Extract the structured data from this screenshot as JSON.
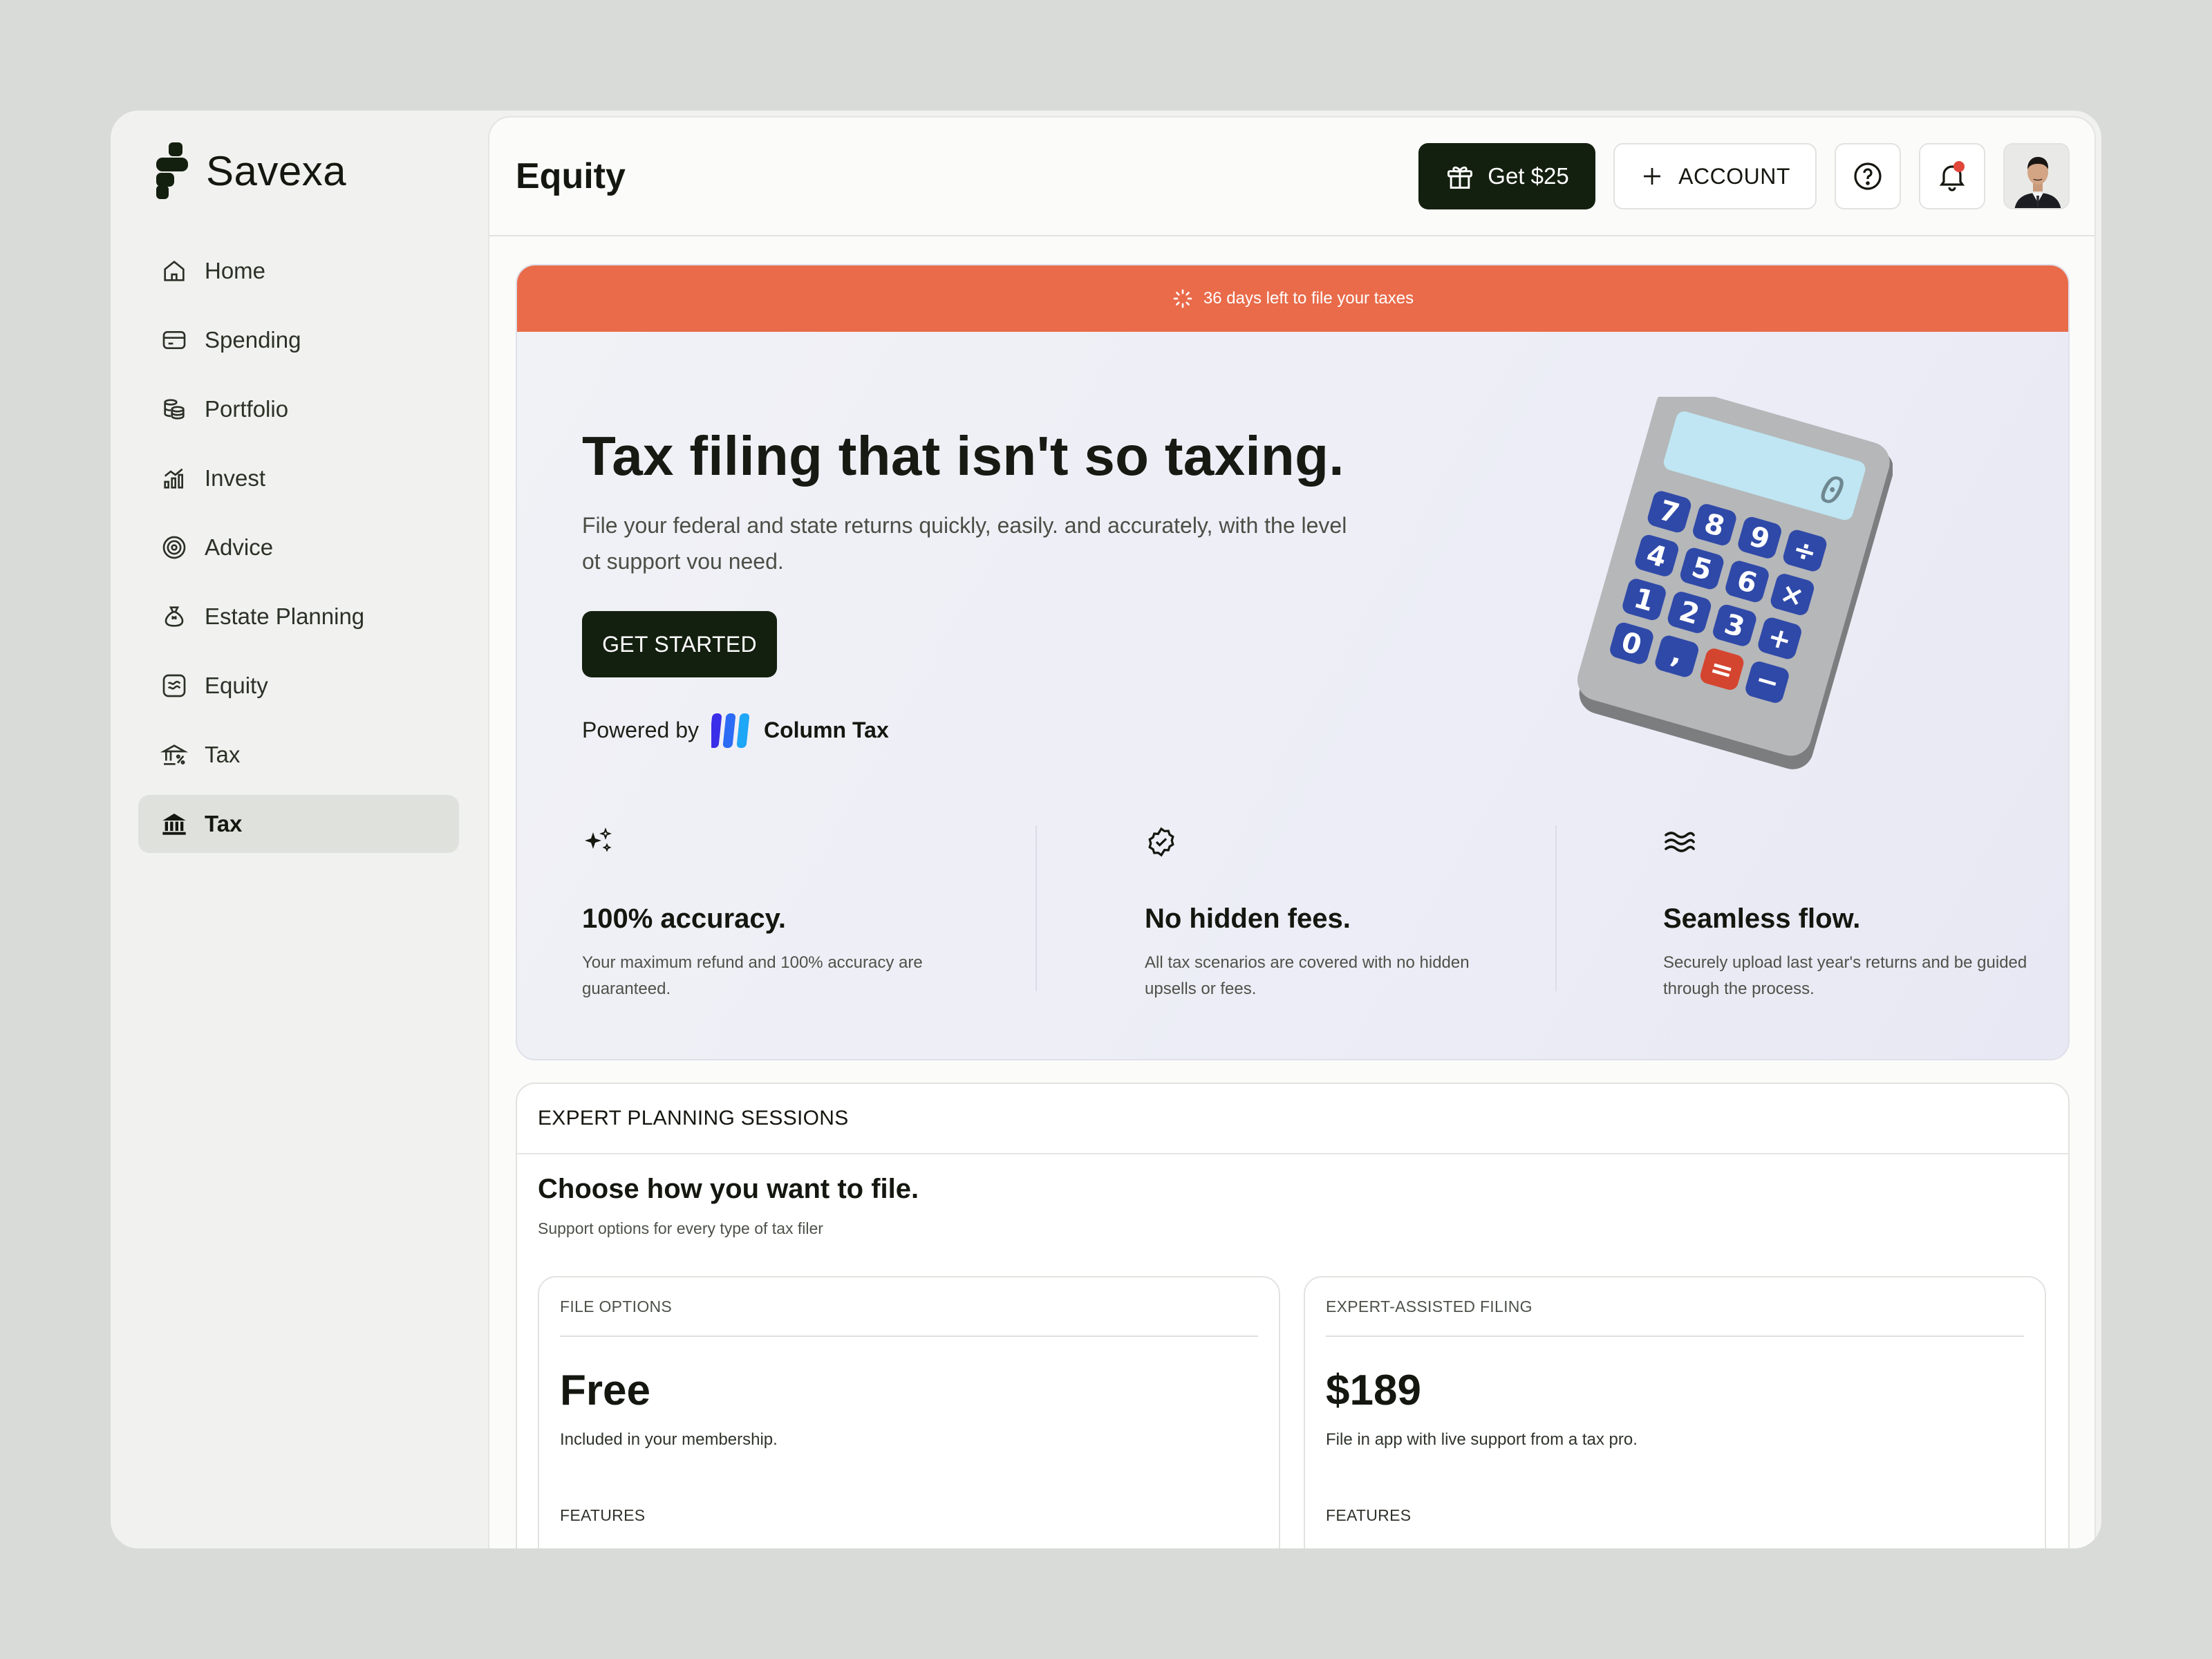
{
  "app": {
    "name": "Savexa"
  },
  "sidebar": {
    "items": [
      {
        "label": "Home",
        "icon": "home-icon"
      },
      {
        "label": "Spending",
        "icon": "card-icon"
      },
      {
        "label": "Portfolio",
        "icon": "coins-icon"
      },
      {
        "label": "Invest",
        "icon": "chart-icon"
      },
      {
        "label": "Advice",
        "icon": "target-icon"
      },
      {
        "label": "Estate Planning",
        "icon": "money-bag-icon"
      },
      {
        "label": "Equity",
        "icon": "equity-icon"
      },
      {
        "label": "Tax",
        "icon": "bank-percent-icon"
      },
      {
        "label": "Tax",
        "icon": "bank-icon",
        "active": true
      }
    ]
  },
  "header": {
    "title": "Equity",
    "gift_label": "Get $25",
    "account_label": "ACCOUNT"
  },
  "banner": {
    "text": "36 days left to file your taxes"
  },
  "hero": {
    "title": "Tax filing that isn't so taxing.",
    "subtitle": "File your federal and state returns quickly, easily. and accurately, with the level ot support vou need.",
    "cta_label": "GET STARTED",
    "powered_prefix": "Powered by",
    "powered_brand": "Column Tax",
    "calculator_display": "0"
  },
  "features": [
    {
      "title": "100% accuracy.",
      "desc": "Your maximum refund and 100% accuracy are guaranteed.",
      "icon": "sparkle-icon"
    },
    {
      "title": "No hidden fees.",
      "desc": "All tax scenarios are covered with no hidden upsells or fees.",
      "icon": "verified-badge-icon"
    },
    {
      "title": "Seamless flow.",
      "desc": "Securely upload last year's returns and be guided through the process.",
      "icon": "waves-icon"
    }
  ],
  "sessions": {
    "header": "EXPERT PLANNING SESSIONS",
    "title": "Choose how you want to file.",
    "subtitle": "Support options for every type of tax filer",
    "plans": [
      {
        "label": "FILE OPTIONS",
        "price": "Free",
        "desc": "Included in your membership.",
        "features_label": "FEATURES"
      },
      {
        "label": "EXPERT-ASSISTED FILING",
        "price": "$189",
        "desc": "File in app with live support from a tax pro.",
        "features_label": "FEATURES"
      }
    ]
  },
  "colors": {
    "brand_dark": "#14200f",
    "banner": "#e96b4a",
    "notification": "#e0463a",
    "sidebar_active": "#dfe1dc"
  }
}
